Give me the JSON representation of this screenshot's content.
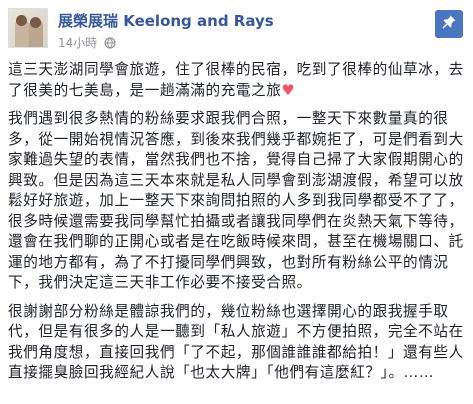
{
  "header": {
    "page_name": "展榮展瑞 Keelong and Rays",
    "timestamp": "14小時",
    "privacy_icon": "globe-icon",
    "pin_icon": "pin-icon",
    "pin_color": "#4a76c0"
  },
  "post": {
    "p1_text": "這三天澎湖同學會旅遊，住了很棒的民宿，吃到了很棒的仙草冰，去了很美的七美島，是一趟滿滿的充電之旅",
    "p1_emoji": "♥",
    "p2": "我們遇到很多熱情的粉絲要求跟我們合照，一整天下來數量真的很多，從一開始視情況答應，到後來我們幾乎都婉拒了，可是們看到大家難過失望的表情，當然我們也不捨，覺得自己掃了大家假期開心的興致。但是因為這三天本來就是私人同學會到澎湖渡假，希望可以放鬆好好旅遊，加上一整天下來詢問拍照的人多到我同學都受不了了，很多時候還需要我同學幫忙拍攝或者讓我同學們在炎熱天氣下等待，還會在我們聊的正開心或者是在吃飯時候來問，甚至在機場關口、託運的地方都有，為了不打擾同學們興致，也對所有粉絲公平的情況下，我們決定這三天非工作必要不接受合照。",
    "p3": "很謝謝部分粉絲是體諒我們的，幾位粉絲也選擇開心的跟我握手取代，但是有很多的人是一聽到「私人旅遊」不方便拍照，完全不站在我們角度想，直接回我們「了不起，那個誰誰誰都給拍！」還有些人直接擺臭臉回我經紀人說「也太大牌」「他們有這麼紅？」。……",
    "heart_color": "#f25268"
  }
}
